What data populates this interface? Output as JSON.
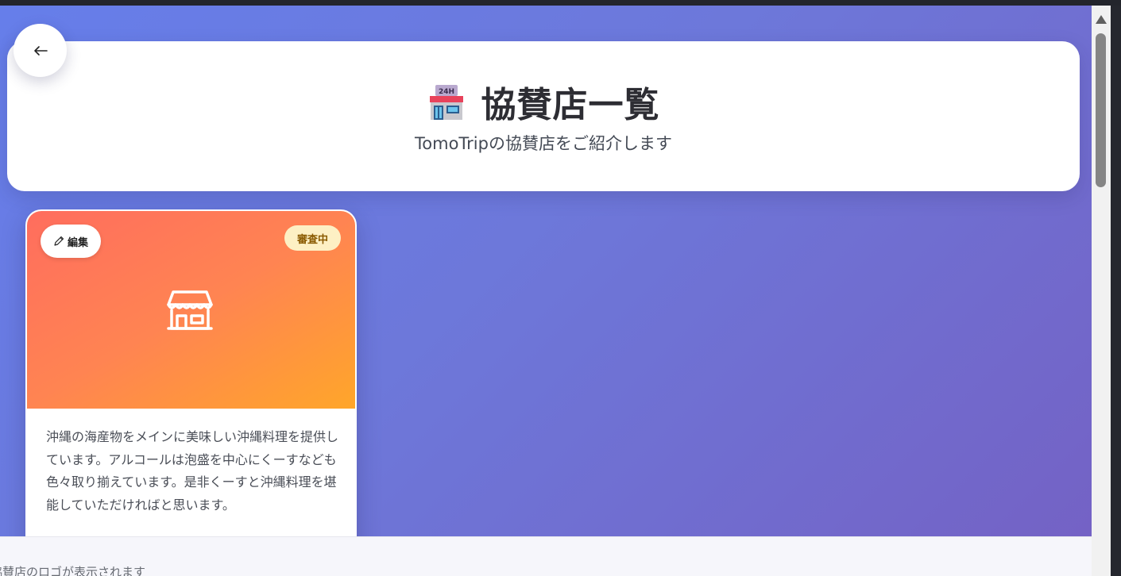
{
  "header": {
    "title": "協賛店一覧",
    "subtitle": "TomoTripの協賛店をご紹介します",
    "emoji_icon": "convenience-store-emoji-icon"
  },
  "back_button": {
    "icon": "arrow-left-icon"
  },
  "sponsor_card": {
    "edit_label": "編集",
    "status": "審査中",
    "description": "沖縄の海産物をメインに美味しい沖縄料理を提供しています。アルコールは泡盛を中心にくーすなども色々取り揃えています。是非くーすと沖縄料理を堪能していただければと思います。",
    "hero_icon": "store-icon"
  },
  "bottom_bar": {
    "text": "協賛店のロゴが表示されます"
  },
  "colors": {
    "background_gradient_start": "#667eea",
    "background_gradient_end": "#7461c4",
    "card_hero_start": "#ff6d5e",
    "card_hero_end": "#ffa62a",
    "status_badge_bg": "#fdf0c4",
    "status_badge_text": "#8a5a00"
  }
}
